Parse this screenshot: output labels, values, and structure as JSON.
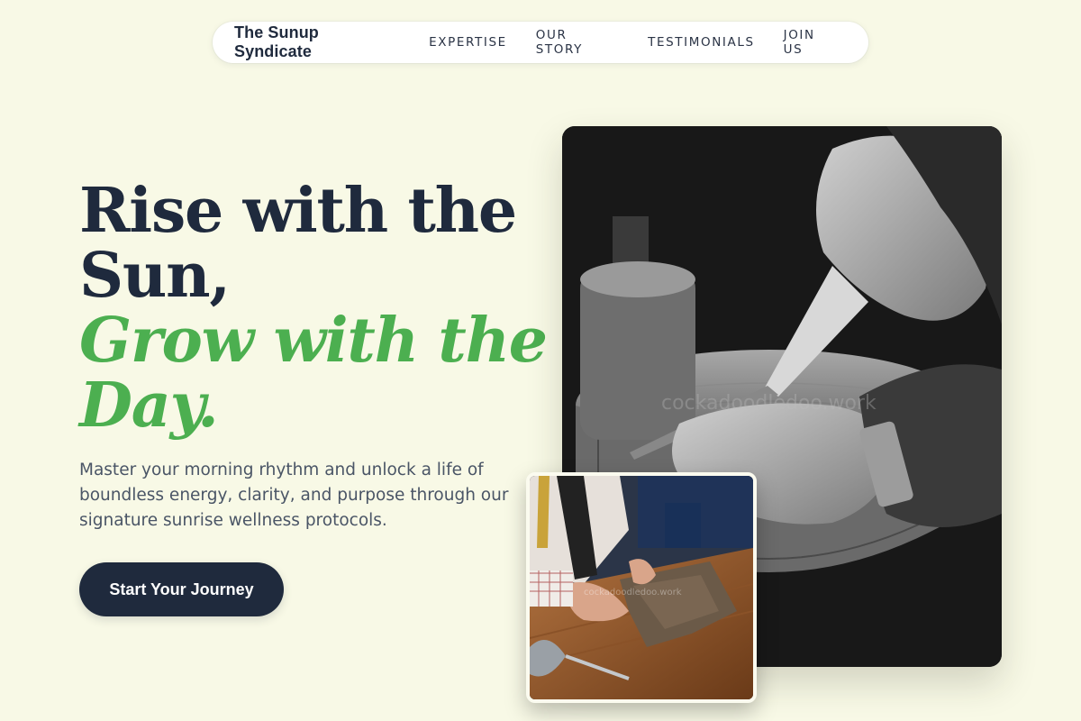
{
  "nav": {
    "brand": "The Sunup Syndicate",
    "links": [
      "EXPERTISE",
      "OUR STORY",
      "TESTIMONIALS",
      "JOIN US"
    ]
  },
  "hero": {
    "headline_line1": "Rise with the",
    "headline_line2": "Sun,",
    "accent_line1": "Grow with the",
    "accent_line2": "Day.",
    "subtext": "Master your morning rhythm and unlock a life of boundless energy, clarity, and purpose through our signature sunrise wellness protocols.",
    "cta_label": "Start Your Journey"
  },
  "images": {
    "main_watermark": "cockadoodledoo.work",
    "small_watermark": "cockadoodledoo.work"
  },
  "colors": {
    "background": "#f8f9e6",
    "navy": "#1f2a3d",
    "accent_green": "#4caf50",
    "body_text": "#4a5566"
  }
}
